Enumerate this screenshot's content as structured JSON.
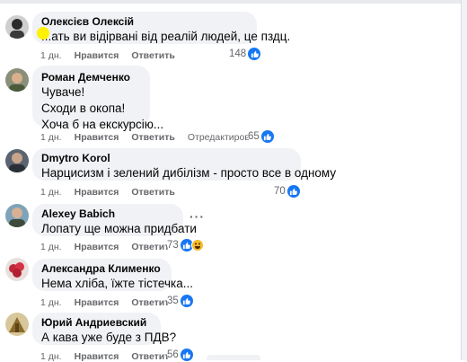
{
  "comments": [
    {
      "author": "Олексієв Олексій",
      "lines": [
        "...ать ви відірвані від реалій людей, це пздц."
      ],
      "time": "1 дн.",
      "like": "Нравится",
      "reply": "Ответить",
      "edited": "",
      "reactions": "148"
    },
    {
      "author": "Роман Демченко",
      "lines": [
        "Чуваче!",
        "Сходи в окопа!",
        "Хоча б на екскурсію..."
      ],
      "time": "1 дн.",
      "like": "Нравится",
      "reply": "Ответить",
      "edited": "Отредактировано",
      "reactions": "65"
    },
    {
      "author": "Dmytro Korol",
      "lines": [
        "Нарцисизм і зелений дибілізм - просто все в одному"
      ],
      "time": "1 дн.",
      "like": "Нравится",
      "reply": "Ответить",
      "edited": "",
      "reactions": "70"
    },
    {
      "author": "Alexey Babich",
      "lines": [
        "Лопату ще можна придбати"
      ],
      "time": "1 дн.",
      "like": "Нравится",
      "reply": "Ответить",
      "edited": "",
      "reactions": "73"
    },
    {
      "author": "Александра Клименко",
      "lines": [
        "Нема хліба, їжте тістечка..."
      ],
      "time": "1 дн.",
      "like": "Нравится",
      "reply": "Ответить",
      "edited": "",
      "reactions": "35"
    },
    {
      "author": "Юрий Андриевский",
      "lines": [
        "А кава уже буде з ПДВ?"
      ],
      "time": "1 дн.",
      "like": "Нравится",
      "reply": "Ответить",
      "edited": "",
      "reactions": "56"
    }
  ],
  "icons": {
    "like": "thumbs-up-icon",
    "haha": "haha-icon",
    "more": "more-options-icon"
  },
  "colors": {
    "bubble": "#f0f2f5",
    "like_blue": "#1877f2",
    "meta_gray": "#65676b",
    "haha_yellow": "#f7b928"
  }
}
